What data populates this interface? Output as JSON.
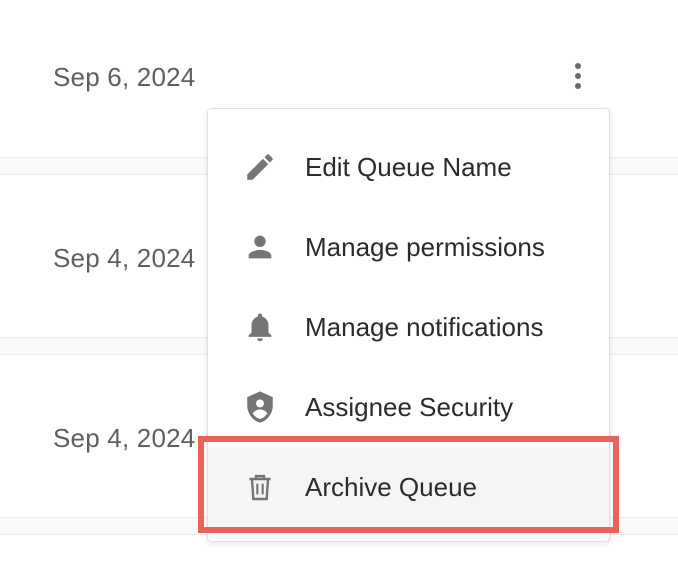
{
  "rows": [
    {
      "date": "Sep 6, 2024"
    },
    {
      "date": "Sep 4, 2024"
    },
    {
      "date": "Sep 4, 2024"
    }
  ],
  "menu": {
    "items": [
      {
        "label": "Edit Queue Name",
        "icon": "pencil-icon"
      },
      {
        "label": "Manage permissions",
        "icon": "person-icon"
      },
      {
        "label": "Manage notifications",
        "icon": "bell-icon"
      },
      {
        "label": "Assignee Security",
        "icon": "shield-person-icon"
      },
      {
        "label": "Archive Queue",
        "icon": "trash-icon"
      }
    ],
    "highlighted_item": "Archive Queue"
  },
  "colors": {
    "icon": "#757575",
    "text": "#2b2b2b",
    "date_text": "#5f5f5f",
    "highlight_border": "#e8645a",
    "hover_bg": "#f5f5f5"
  }
}
